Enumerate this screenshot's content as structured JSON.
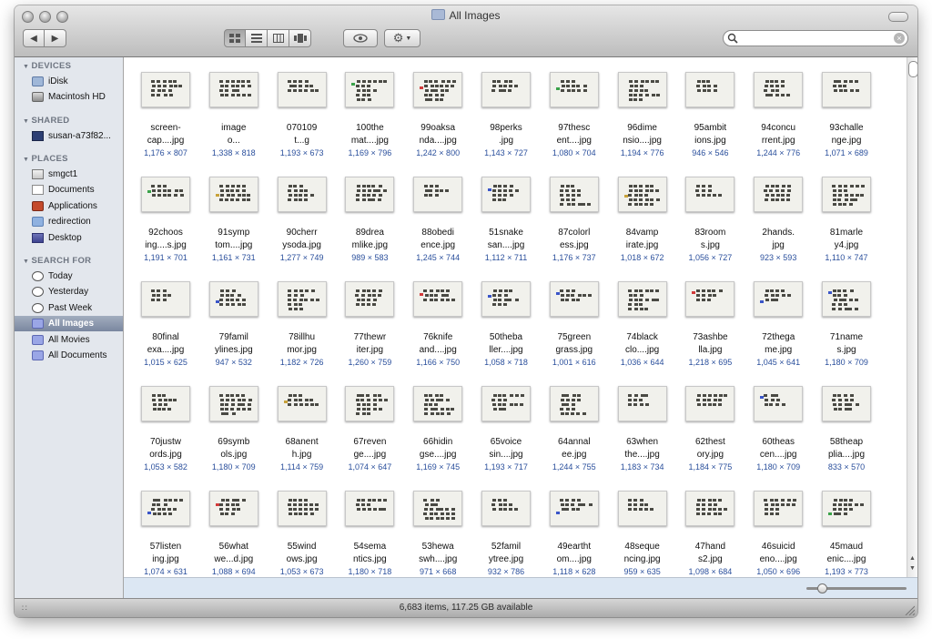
{
  "window": {
    "title": "All Images"
  },
  "toolbar": {
    "search_placeholder": ""
  },
  "sidebar": {
    "devices_header": "DEVICES",
    "devices": [
      "iDisk",
      "Macintosh HD"
    ],
    "shared_header": "SHARED",
    "shared": [
      "susan-a73f82..."
    ],
    "places_header": "PLACES",
    "places": [
      "smgct1",
      "Documents",
      "Applications",
      "redirection",
      "Desktop"
    ],
    "search_header": "SEARCH FOR",
    "search": [
      "Today",
      "Yesterday",
      "Past Week",
      "All Images",
      "All Movies",
      "All Documents"
    ],
    "selected": "All Images"
  },
  "files": [
    {
      "l1": "screen-",
      "l2": "cap....jpg",
      "dim": "1,176 × 807"
    },
    {
      "l1": "image",
      "l2": "o...",
      "dim": "1,338 × 818"
    },
    {
      "l1": "070109",
      "l2": "t...g",
      "dim": "1,193 × 673"
    },
    {
      "l1": "100the",
      "l2": "mat....jpg",
      "dim": "1,169 × 796"
    },
    {
      "l1": "99oaksa",
      "l2": "nda....jpg",
      "dim": "1,242 × 800"
    },
    {
      "l1": "98perks",
      "l2": ".jpg",
      "dim": "1,143 × 727"
    },
    {
      "l1": "97thesc",
      "l2": "ent....jpg",
      "dim": "1,080 × 704"
    },
    {
      "l1": "96dime",
      "l2": "nsio....jpg",
      "dim": "1,194 × 776"
    },
    {
      "l1": "95ambit",
      "l2": "ions.jpg",
      "dim": "946 × 546"
    },
    {
      "l1": "94concu",
      "l2": "rrent.jpg",
      "dim": "1,244 × 776"
    },
    {
      "l1": "93challe",
      "l2": "nge.jpg",
      "dim": "1,071 × 689"
    },
    {
      "l1": "92choos",
      "l2": "ing....s.jpg",
      "dim": "1,191 × 701"
    },
    {
      "l1": "91symp",
      "l2": "tom....jpg",
      "dim": "1,161 × 731"
    },
    {
      "l1": "90cherr",
      "l2": "ysoda.jpg",
      "dim": "1,277 × 749"
    },
    {
      "l1": "89drea",
      "l2": "mlike.jpg",
      "dim": "989 × 583"
    },
    {
      "l1": "88obedi",
      "l2": "ence.jpg",
      "dim": "1,245 × 744"
    },
    {
      "l1": "51snake",
      "l2": "san....jpg",
      "dim": "1,112 × 711"
    },
    {
      "l1": "87colorl",
      "l2": "ess.jpg",
      "dim": "1,176 × 737"
    },
    {
      "l1": "84vamp",
      "l2": "irate.jpg",
      "dim": "1,018 × 672"
    },
    {
      "l1": "83room",
      "l2": "s.jpg",
      "dim": "1,056 × 727"
    },
    {
      "l1": "2hands.",
      "l2": "jpg",
      "dim": "923 × 593"
    },
    {
      "l1": "81marle",
      "l2": "y4.jpg",
      "dim": "1,110 × 747"
    },
    {
      "l1": "80final",
      "l2": "exa....jpg",
      "dim": "1,015 × 625"
    },
    {
      "l1": "79famil",
      "l2": "ylines.jpg",
      "dim": "947 × 532"
    },
    {
      "l1": "78illhu",
      "l2": "mor.jpg",
      "dim": "1,182 × 726"
    },
    {
      "l1": "77thewr",
      "l2": "iter.jpg",
      "dim": "1,260 × 759"
    },
    {
      "l1": "76knife",
      "l2": "and....jpg",
      "dim": "1,166 × 750"
    },
    {
      "l1": "50theba",
      "l2": "ller....jpg",
      "dim": "1,058 × 718"
    },
    {
      "l1": "75green",
      "l2": "grass.jpg",
      "dim": "1,001 × 616"
    },
    {
      "l1": "74black",
      "l2": "clo....jpg",
      "dim": "1,036 × 644"
    },
    {
      "l1": "73ashbe",
      "l2": "lla.jpg",
      "dim": "1,218 × 695"
    },
    {
      "l1": "72thega",
      "l2": "me.jpg",
      "dim": "1,045 × 641"
    },
    {
      "l1": "71name",
      "l2": "s.jpg",
      "dim": "1,180 × 709"
    },
    {
      "l1": "70justw",
      "l2": "ords.jpg",
      "dim": "1,053 × 582"
    },
    {
      "l1": "69symb",
      "l2": "ols.jpg",
      "dim": "1,180 × 709"
    },
    {
      "l1": "68anent",
      "l2": "h.jpg",
      "dim": "1,114 × 759"
    },
    {
      "l1": "67reven",
      "l2": "ge....jpg",
      "dim": "1,074 × 647"
    },
    {
      "l1": "66hidin",
      "l2": "gse....jpg",
      "dim": "1,169 × 745"
    },
    {
      "l1": "65voice",
      "l2": "sin....jpg",
      "dim": "1,193 × 717"
    },
    {
      "l1": "64annal",
      "l2": "ee.jpg",
      "dim": "1,244 × 755"
    },
    {
      "l1": "63when",
      "l2": "the....jpg",
      "dim": "1,183 × 734"
    },
    {
      "l1": "62thest",
      "l2": "ory.jpg",
      "dim": "1,184 × 775"
    },
    {
      "l1": "60theas",
      "l2": "cen....jpg",
      "dim": "1,180 × 709"
    },
    {
      "l1": "58theap",
      "l2": "plia....jpg",
      "dim": "833 × 570"
    },
    {
      "l1": "57listen",
      "l2": "ing.jpg",
      "dim": "1,074 × 631"
    },
    {
      "l1": "56what",
      "l2": "we...d.jpg",
      "dim": "1,088 × 694"
    },
    {
      "l1": "55wind",
      "l2": "ows.jpg",
      "dim": "1,053 × 673"
    },
    {
      "l1": "54sema",
      "l2": "ntics.jpg",
      "dim": "1,180 × 718"
    },
    {
      "l1": "53hewa",
      "l2": "swh....jpg",
      "dim": "971 × 668"
    },
    {
      "l1": "52famil",
      "l2": "ytree.jpg",
      "dim": "932 × 786"
    },
    {
      "l1": "49eartht",
      "l2": "om....jpg",
      "dim": "1,118 × 628"
    },
    {
      "l1": "48seque",
      "l2": "ncing.jpg",
      "dim": "959 × 635"
    },
    {
      "l1": "47hand",
      "l2": "s2.jpg",
      "dim": "1,098 × 684"
    },
    {
      "l1": "46suicid",
      "l2": "eno....jpg",
      "dim": "1,050 × 696"
    },
    {
      "l1": "45maud",
      "l2": "enic....jpg",
      "dim": "1,193 × 773"
    }
  ],
  "status": {
    "text": "6,683 items, 117.25 GB available"
  },
  "icons": {
    "back": "chevron-left-icon",
    "forward": "chevron-right-icon",
    "view_icon": "icon-view-icon",
    "view_list": "list-view-icon",
    "view_column": "column-view-icon",
    "view_coverflow": "coverflow-view-icon",
    "quicklook": "eye-icon",
    "action": "gear-icon",
    "search": "magnifier-icon",
    "clear": "clear-icon"
  }
}
